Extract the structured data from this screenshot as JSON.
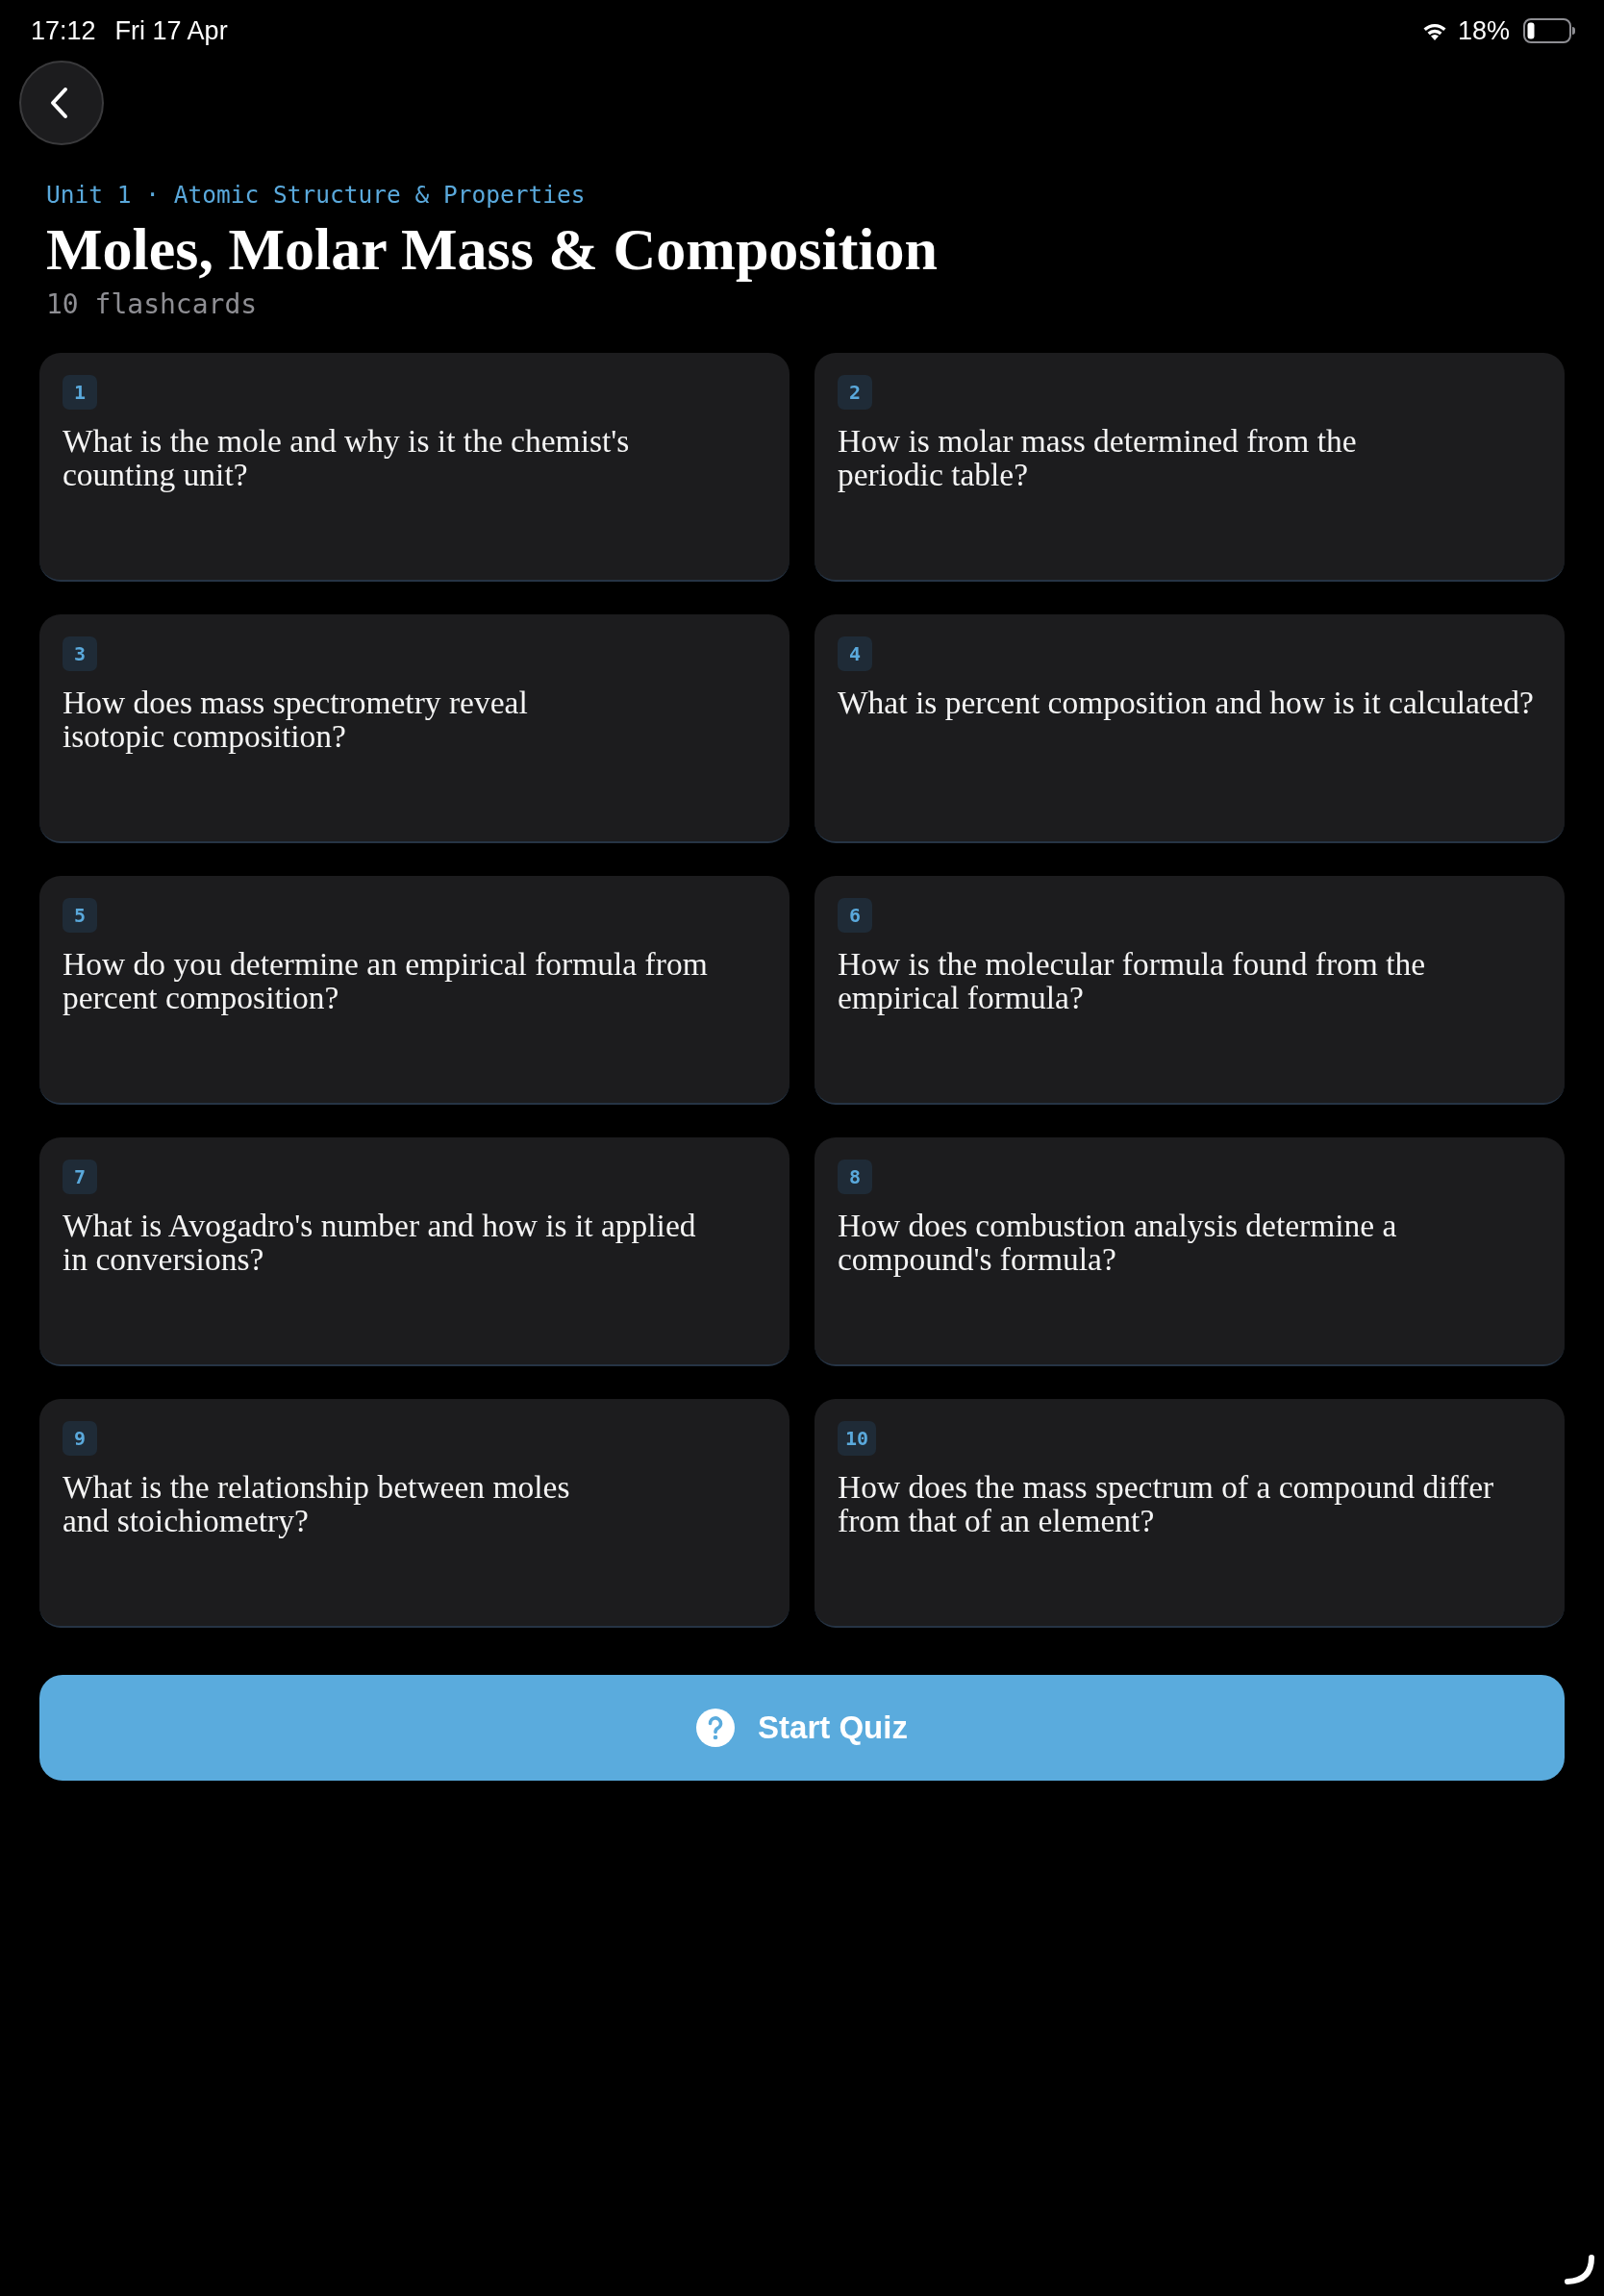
{
  "status_bar": {
    "time": "17:12",
    "date": "Fri 17 Apr",
    "battery": "18%"
  },
  "header": {
    "breadcrumb": "Unit 1 · Atomic Structure & Properties",
    "title": "Moles, Molar Mass & Composition",
    "count": "10 flashcards"
  },
  "cards": [
    {
      "number": "1",
      "question": "What is the mole and why is it the chemist's counting unit?"
    },
    {
      "number": "2",
      "question": "How is molar mass determined from the periodic table?"
    },
    {
      "number": "3",
      "question": "How does mass spectrometry reveal isotopic composition?"
    },
    {
      "number": "4",
      "question": "What is percent composition and how is it calculated?"
    },
    {
      "number": "5",
      "question": "How do you determine an empirical formula from percent composition?"
    },
    {
      "number": "6",
      "question": "How is the molecular formula found from the empirical formula?"
    },
    {
      "number": "7",
      "question": "What is Avogadro's number and how is it applied in conversions?"
    },
    {
      "number": "8",
      "question": "How does combustion analysis determine a compound's formula?"
    },
    {
      "number": "9",
      "question": "What is the relationship between moles and stoichiometry?"
    },
    {
      "number": "10",
      "question": "How does the mass spectrum of a compound differ from that of an element?"
    }
  ],
  "start_button": {
    "label": "Start Quiz"
  }
}
